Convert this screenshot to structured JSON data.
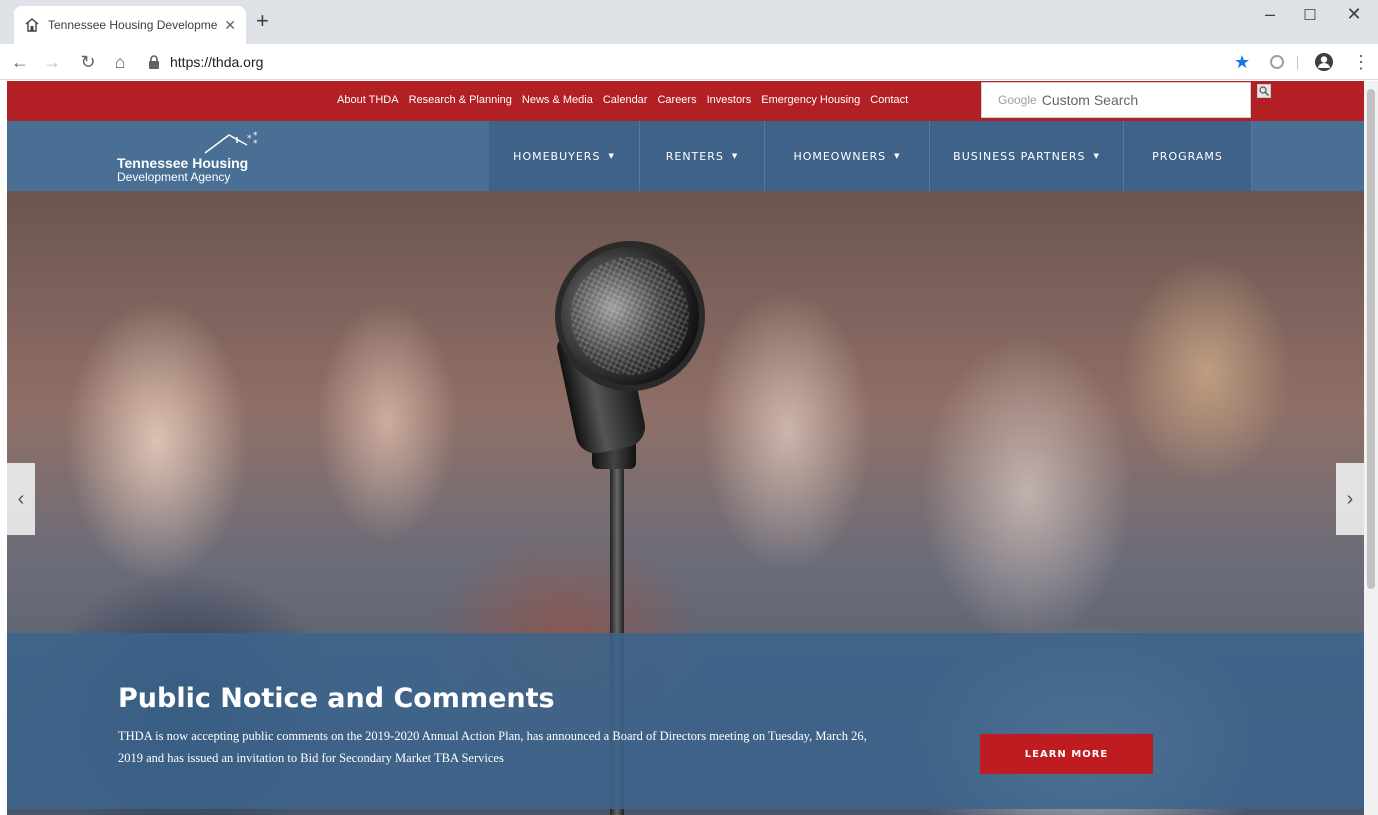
{
  "browser": {
    "tab_title": "Tennessee Housing Developmen",
    "new_tab_label": "+",
    "url": "https://thda.org",
    "window_controls": {
      "minimize": "–",
      "maximize": "☐",
      "close": "✕"
    },
    "icons": [
      "thda-favicon",
      "back-icon",
      "forward-icon",
      "reload-icon",
      "home-icon",
      "lock-icon",
      "star-icon",
      "extension-icon",
      "profile-icon",
      "menu-icon"
    ],
    "accent_color": "#1a73e8"
  },
  "utility_nav": {
    "links": [
      "About THDA",
      "Research & Planning",
      "News & Media",
      "Calendar",
      "Careers",
      "Investors",
      "Emergency Housing",
      "Contact"
    ],
    "search": {
      "brand": "Google",
      "placeholder": "Custom Search"
    },
    "color": "#b21f24"
  },
  "main_nav": {
    "logo": {
      "line1": "Tennessee Housing",
      "line2": "Development Agency"
    },
    "items": [
      {
        "label": "HOMEBUYERS",
        "has_dropdown": true
      },
      {
        "label": "RENTERS",
        "has_dropdown": true
      },
      {
        "label": "HOMEOWNERS",
        "has_dropdown": true
      },
      {
        "label": "BUSINESS PARTNERS",
        "has_dropdown": true
      },
      {
        "label": "PROGRAMS",
        "has_dropdown": false
      }
    ],
    "caret": "▼",
    "color": "#4a6f94"
  },
  "hero": {
    "prev_label": "‹",
    "next_label": "›",
    "title": "Public Notice and Comments",
    "text": "THDA is now accepting public comments on the 2019-2020 Annual Action Plan, has announced a Board of Directors meeting on Tuesday, March 26, 2019 and has issued an invitation to Bid for Secondary Market TBA Services",
    "cta": "LEARN MORE"
  }
}
